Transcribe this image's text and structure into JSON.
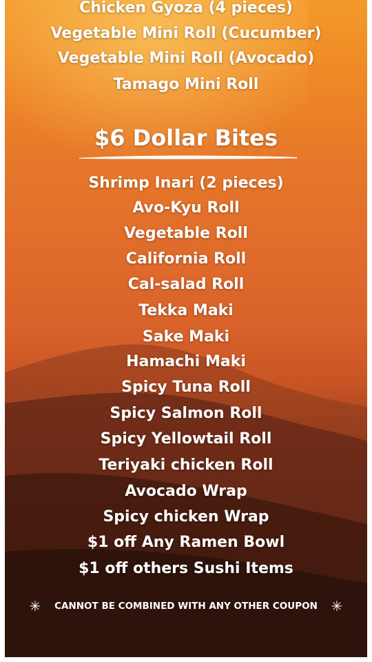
{
  "menu": {
    "top_items": [
      "Chicken Gyoza (4 pieces)",
      "Vegetable Mini Roll (Cucumber)",
      "Vegetable Mini Roll (Avocado)",
      "Tamago Mini Roll"
    ],
    "section_title": "$6 Dollar Bites",
    "items": [
      "Shrimp Inari (2 pieces)",
      "Avo-Kyu Roll",
      "Vegetable Roll",
      "California Roll",
      "Cal-salad Roll",
      "Tekka Maki",
      "Sake Maki",
      "Hamachi Maki",
      "Spicy Tuna Roll",
      "Spicy Salmon Roll",
      "Spicy Yellowtail Roll",
      "Teriyaki chicken Roll",
      "Avocado Wrap",
      "Spicy chicken Wrap",
      "$1 off Any Ramen Bowl",
      "$1 off others Sushi Items"
    ],
    "disclaimer": "CANNOT BE COMBINED WITH ANY OTHER COUPON",
    "star_glyph": "✳"
  },
  "colors": {
    "sky_top": "#f39a2b",
    "sky_mid": "#d8622a",
    "ground": "#2b120c",
    "text": "#ffffff"
  }
}
